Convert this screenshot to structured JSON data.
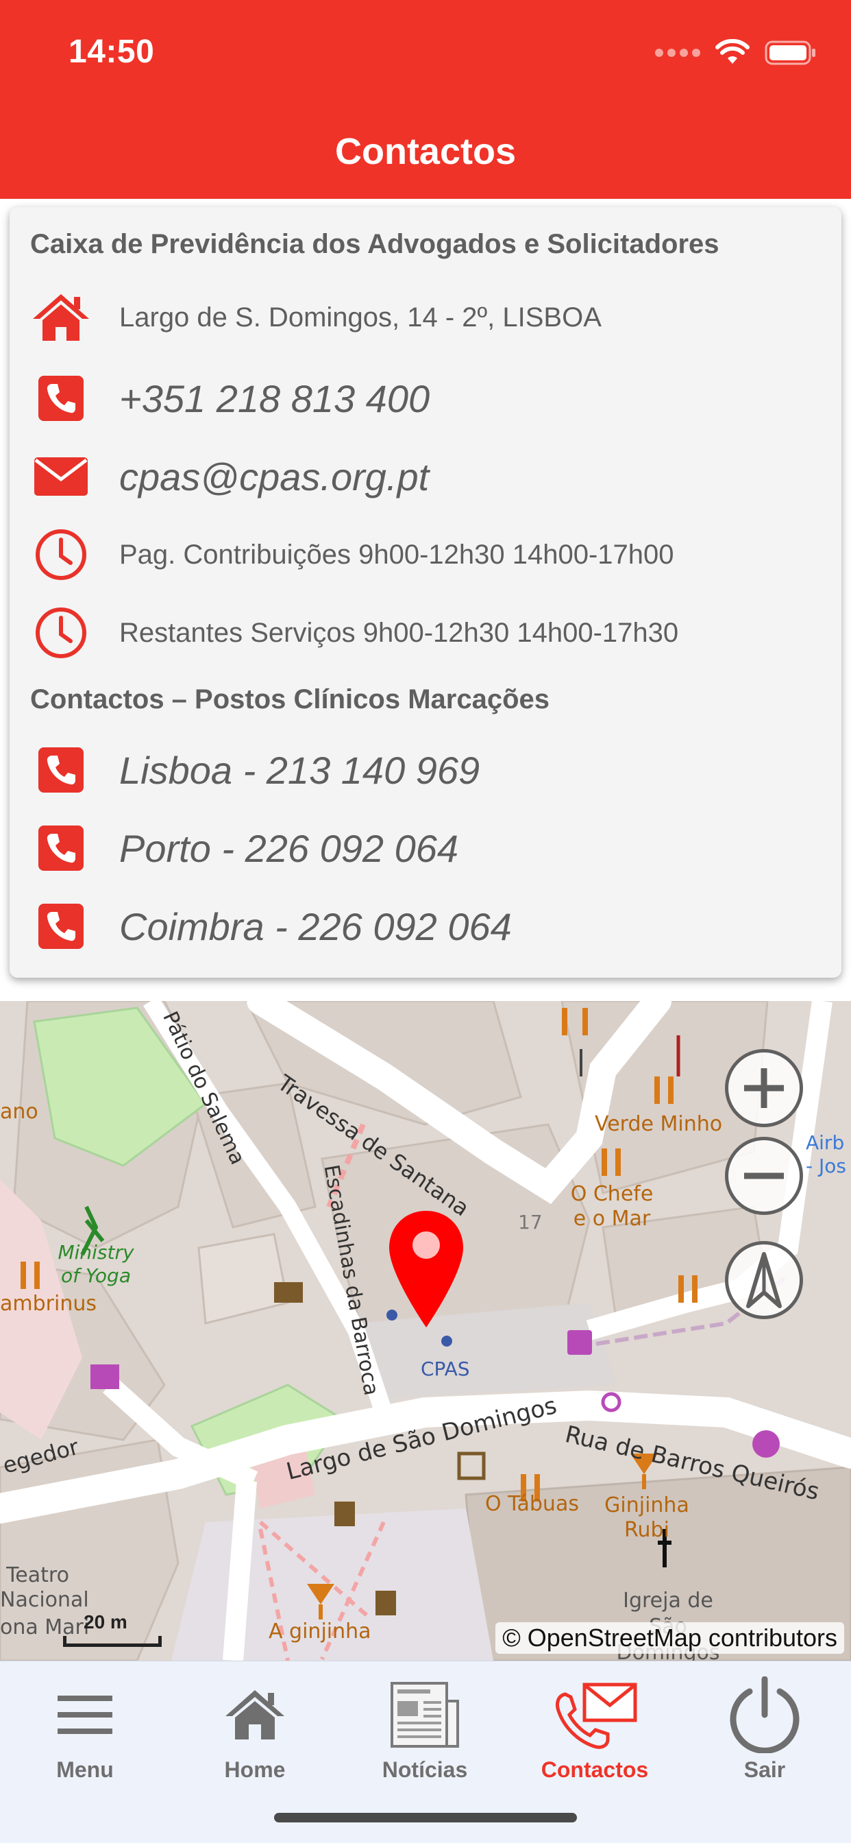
{
  "status": {
    "time": "14:50"
  },
  "header": {
    "title": "Contactos"
  },
  "contacts": {
    "org_name": "Caixa de Previdência dos Advogados e Solicitadores",
    "address": "Largo de S. Domingos, 14 - 2º, LISBOA",
    "phone": "+351 218 813 400",
    "email": "cpas@cpas.org.pt",
    "hours_contributions": "Pag. Contribuições 9h00-12h30 14h00-17h00",
    "hours_other": "Restantes Serviços 9h00-12h30 14h00-17h30",
    "clinics_title": "Contactos – Postos Clínicos Marcações",
    "clinic_lisboa": "Lisboa - 213 140 969",
    "clinic_porto": "Porto - 226 092 064",
    "clinic_coimbra": "Coimbra - 226 092 064"
  },
  "map": {
    "labels": {
      "travessa": "Travessa de Santana",
      "patio": "Pátio do Salema",
      "escadinhas": "Escadinhas da Barroca",
      "largo": "Largo de São Domingos",
      "rua": "Rua de Barros Queirós",
      "verde_minho": "Verde Minho",
      "chefe": "O Chefe e o Mar",
      "number17": "17",
      "cpas": "CPAS",
      "ministry": "Ministry of Yoga",
      "ambrinus": "ambrinus",
      "regedor": "egedor",
      "teatro": "Teatro Nacional",
      "dona_maria": "ona Mari",
      "tabuas": "O Tábuas",
      "ginjinha_rubi": "Ginjinha Rubi",
      "igreja": "Igreja de São Domingos",
      "aginjinha": "A ginjinha",
      "airbus": "Airb - Jos",
      "ano": "ano"
    },
    "scale": "20 m",
    "attribution": "© OpenStreetMap contributors",
    "colors": {
      "marker": "#ff0000",
      "road": "#ffffff",
      "building": "#d9d0c9"
    }
  },
  "tabs": {
    "menu": "Menu",
    "home": "Home",
    "news": "Notícias",
    "contacts": "Contactos",
    "exit": "Sair"
  },
  "colors": {
    "brand": "#ef3328",
    "text": "#5e5e5e",
    "tab_inactive": "#6f6f6f"
  }
}
